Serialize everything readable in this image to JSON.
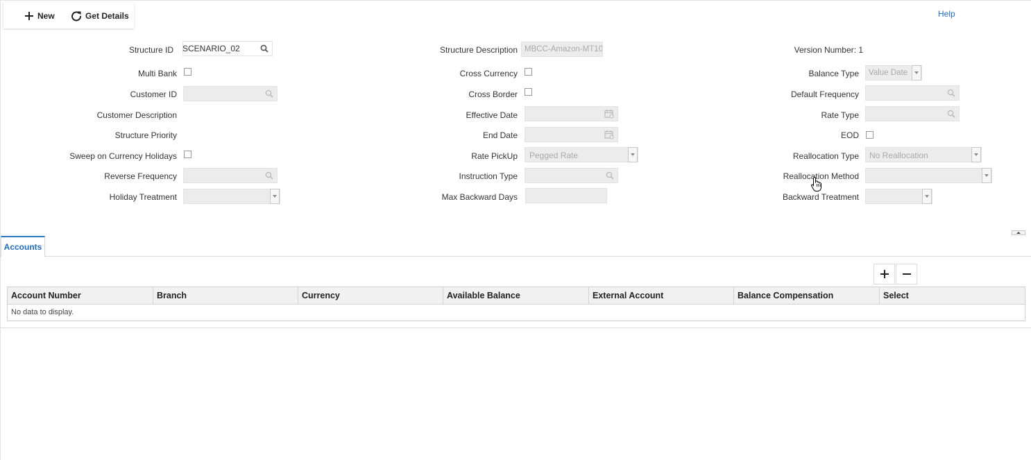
{
  "toolbar": {
    "new_label": "New",
    "get_details_label": "Get Details",
    "help_label": "Help"
  },
  "form": {
    "structure_id": {
      "label": "Structure ID",
      "value": "SCENARIO_02"
    },
    "multi_bank": {
      "label": "Multi Bank"
    },
    "customer_id": {
      "label": "Customer ID"
    },
    "customer_description": {
      "label": "Customer Description"
    },
    "structure_priority": {
      "label": "Structure Priority"
    },
    "sweep_on_currency_holidays": {
      "label": "Sweep on Currency Holidays"
    },
    "reverse_frequency": {
      "label": "Reverse Frequency"
    },
    "holiday_treatment": {
      "label": "Holiday Treatment"
    },
    "structure_description": {
      "label": "Structure Description",
      "value": "MBCC-Amazon-MT10"
    },
    "cross_currency": {
      "label": "Cross Currency"
    },
    "cross_border": {
      "label": "Cross Border"
    },
    "effective_date": {
      "label": "Effective Date"
    },
    "end_date": {
      "label": "End Date"
    },
    "rate_pickup": {
      "label": "Rate PickUp",
      "value": "Pegged Rate"
    },
    "instruction_type": {
      "label": "Instruction Type"
    },
    "max_backward_days": {
      "label": "Max Backward Days"
    },
    "version_number": {
      "label": "Version Number: 1"
    },
    "balance_type": {
      "label": "Balance Type",
      "value": "Value Date"
    },
    "default_frequency": {
      "label": "Default Frequency"
    },
    "rate_type": {
      "label": "Rate Type"
    },
    "eod": {
      "label": "EOD"
    },
    "reallocation_type": {
      "label": "Reallocation Type",
      "value": "No Reallocation"
    },
    "reallocation_method": {
      "label": "Reallocation Method"
    },
    "backward_treatment": {
      "label": "Backward Treatment"
    }
  },
  "tabs": [
    {
      "label": "Accounts",
      "active": true
    }
  ],
  "table": {
    "add_label": "+",
    "remove_label": "−",
    "columns": [
      "Account Number",
      "Branch",
      "Currency",
      "Available Balance",
      "External Account",
      "Balance Compensation",
      "Select"
    ],
    "empty_text": "No data to display."
  },
  "colors": {
    "accent": "#1f6ab5",
    "tab_border": "#2b78c2",
    "disabled_field": "#ececec"
  }
}
